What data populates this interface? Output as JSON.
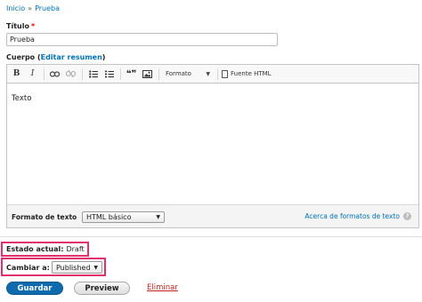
{
  "breadcrumb": {
    "home": "Inicio",
    "separator": "»",
    "current": "Prueba"
  },
  "title_field": {
    "label": "Título",
    "required_mark": "*",
    "value": "Prueba"
  },
  "body_field": {
    "label": "Cuerpo (",
    "summary_link": "Editar resumen",
    "label_end": ")"
  },
  "toolbar": {
    "bold": "B",
    "italic": "I",
    "link_icon": "link-icon",
    "unlink_icon": "unlink-icon",
    "bullet_list_icon": "bulleted-list-icon",
    "numbered_list_icon": "numbered-list-icon",
    "blockquote": "❝❞",
    "image_icon": "image-icon",
    "format_dropdown": "Formato",
    "source_button": "Fuente HTML"
  },
  "editor": {
    "content": "Texto"
  },
  "text_format": {
    "label": "Formato de texto",
    "selected": "HTML básico",
    "help_link": "Acerca de formatos de texto",
    "help_icon": "?"
  },
  "moderation": {
    "current_state_label": "Estado actual:",
    "current_state_value": "Draft",
    "change_to_label": "Cambiar a:",
    "change_to_value": "Published"
  },
  "actions": {
    "save": "Guardar",
    "preview": "Preview",
    "delete": "Eliminar"
  },
  "colors": {
    "link": "#0071b3",
    "primary": "#0e6aac",
    "highlight": "#e0316e",
    "danger": "#c0231f"
  }
}
